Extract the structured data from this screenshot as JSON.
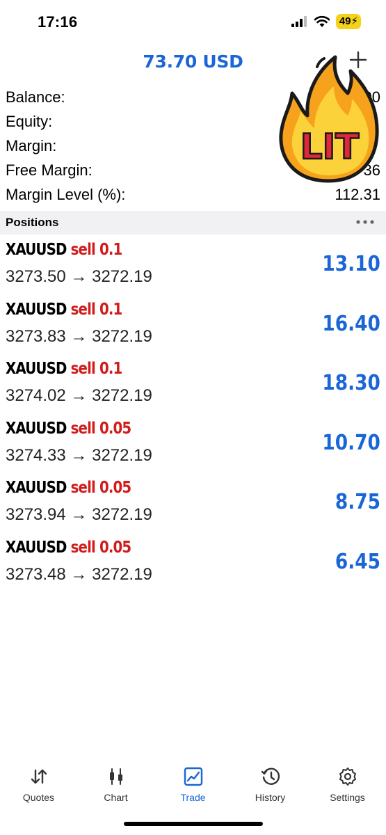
{
  "status_bar": {
    "time": "17:16",
    "battery": "49"
  },
  "header": {
    "title": "73.70 USD"
  },
  "summary": [
    {
      "label": "Balance:",
      "value": "1.00"
    },
    {
      "label": "Equity:",
      "value": ""
    },
    {
      "label": "Margin:",
      "value": ""
    },
    {
      "label": "Free Margin:",
      "value": "36"
    },
    {
      "label": "Margin Level (%):",
      "value": "112.31"
    }
  ],
  "positions_header": {
    "title": "Positions"
  },
  "positions": [
    {
      "symbol": "XAUUSD",
      "side": "sell 0.1",
      "prices": "3273.50 → 3272.19",
      "profit": "13.10"
    },
    {
      "symbol": "XAUUSD",
      "side": "sell 0.1",
      "prices": "3273.83 → 3272.19",
      "profit": "16.40"
    },
    {
      "symbol": "XAUUSD",
      "side": "sell 0.1",
      "prices": "3274.02 → 3272.19",
      "profit": "18.30"
    },
    {
      "symbol": "XAUUSD",
      "side": "sell 0.05",
      "prices": "3274.33 → 3272.19",
      "profit": "10.70"
    },
    {
      "symbol": "XAUUSD",
      "side": "sell 0.05",
      "prices": "3273.94 → 3272.19",
      "profit": "8.75"
    },
    {
      "symbol": "XAUUSD",
      "side": "sell 0.05",
      "prices": "3273.48 → 3272.19",
      "profit": "6.45"
    }
  ],
  "sticker": {
    "text": "LIT"
  },
  "tabs": [
    {
      "label": "Quotes",
      "icon": "quotes-icon",
      "active": false
    },
    {
      "label": "Chart",
      "icon": "chart-icon",
      "active": false
    },
    {
      "label": "Trade",
      "icon": "trade-icon",
      "active": true
    },
    {
      "label": "History",
      "icon": "history-icon",
      "active": false
    },
    {
      "label": "Settings",
      "icon": "settings-icon",
      "active": false
    }
  ],
  "colors": {
    "accent": "#1a66d6",
    "sell": "#d21c1c",
    "section_bg": "#f1f1f3"
  }
}
